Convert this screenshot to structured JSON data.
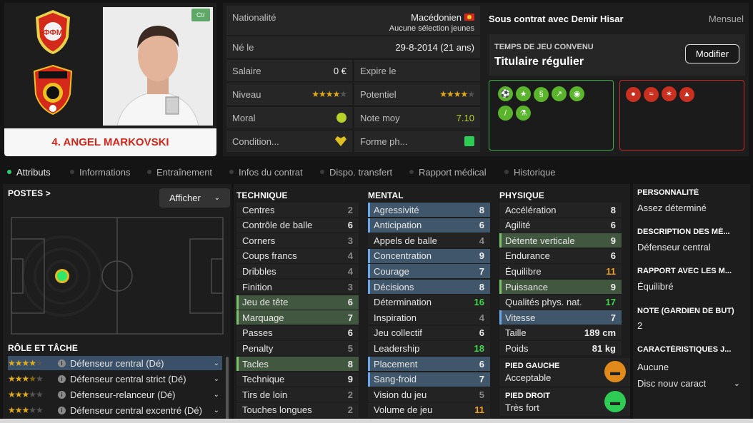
{
  "player": {
    "name": "4. ANGEL MARKOVSKI",
    "position_badge": "Ctr"
  },
  "info": {
    "nationality_label": "Nationalité",
    "nationality": "Macédonien",
    "nationality_sub": "Aucune sélection jeunes",
    "born_label": "Né le",
    "born": "29-8-2014 (21 ans)",
    "salary_label": "Salaire",
    "salary": "0 €",
    "expires_label": "Expire le",
    "level_label": "Niveau",
    "level_stars": 4,
    "potential_label": "Potentiel",
    "potential_stars": 4,
    "morale_label": "Moral",
    "rating_label": "Note moy",
    "rating": "7.10",
    "condition_label": "Condition...",
    "form_label": "Forme ph..."
  },
  "contract": {
    "title": "Sous contrat avec Demir Hisar",
    "type": "Mensuel",
    "playing_time_label": "TEMPS DE JEU CONVENU",
    "playing_time": "Titulaire régulier",
    "modify_label": "Modifier"
  },
  "traits": {
    "positive_icons": [
      "trait-boot-icon",
      "trait-star-icon",
      "trait-dna-icon",
      "trait-growth-icon",
      "trait-brain-icon",
      "trait-bandage-icon",
      "trait-flask-icon"
    ],
    "negative_icons": [
      "trait-ball-icon",
      "trait-tape-icon",
      "trait-injury-icon",
      "trait-warning-icon"
    ],
    "positive_color": "#5ab52c",
    "negative_color": "#c9301f"
  },
  "tabs": [
    "Attributs",
    "Informations",
    "Entraînement",
    "Infos du contrat",
    "Dispo. transfert",
    "Rapport médical",
    "Historique"
  ],
  "positions": {
    "title": "POSTES",
    "show_label": "Afficher"
  },
  "roles": {
    "title": "RÔLE ET TÂCHE",
    "items": [
      {
        "label": "Défenseur central (Dé)",
        "stars": 4
      },
      {
        "label": "Défenseur central strict (Dé)",
        "stars": 3.5
      },
      {
        "label": "Défenseur-relanceur (Dé)",
        "stars": 3
      },
      {
        "label": "Défenseur central excentré (Dé)",
        "stars": 3
      }
    ]
  },
  "technique": {
    "title": "TECHNIQUE",
    "items": [
      {
        "label": "Centres",
        "value": "2",
        "hl": "",
        "c": "lo"
      },
      {
        "label": "Contrôle de balle",
        "value": "6",
        "hl": "",
        "c": ""
      },
      {
        "label": "Corners",
        "value": "3",
        "hl": "",
        "c": "lo"
      },
      {
        "label": "Coups francs",
        "value": "4",
        "hl": "",
        "c": "lo"
      },
      {
        "label": "Dribbles",
        "value": "4",
        "hl": "",
        "c": "lo"
      },
      {
        "label": "Finition",
        "value": "3",
        "hl": "",
        "c": "lo"
      },
      {
        "label": "Jeu de tête",
        "value": "6",
        "hl": "g",
        "c": ""
      },
      {
        "label": "Marquage",
        "value": "7",
        "hl": "g",
        "c": ""
      },
      {
        "label": "Passes",
        "value": "6",
        "hl": "",
        "c": ""
      },
      {
        "label": "Penalty",
        "value": "5",
        "hl": "",
        "c": "lo"
      },
      {
        "label": "Tacles",
        "value": "8",
        "hl": "g",
        "c": ""
      },
      {
        "label": "Technique",
        "value": "9",
        "hl": "",
        "c": ""
      },
      {
        "label": "Tirs de loin",
        "value": "2",
        "hl": "",
        "c": "lo"
      },
      {
        "label": "Touches longues",
        "value": "2",
        "hl": "",
        "c": "lo"
      }
    ]
  },
  "mental": {
    "title": "MENTAL",
    "items": [
      {
        "label": "Agressivité",
        "value": "8",
        "hl": "b",
        "c": ""
      },
      {
        "label": "Anticipation",
        "value": "6",
        "hl": "b",
        "c": ""
      },
      {
        "label": "Appels de balle",
        "value": "4",
        "hl": "",
        "c": "lo"
      },
      {
        "label": "Concentration",
        "value": "9",
        "hl": "b",
        "c": ""
      },
      {
        "label": "Courage",
        "value": "7",
        "hl": "b",
        "c": ""
      },
      {
        "label": "Décisions",
        "value": "8",
        "hl": "b",
        "c": ""
      },
      {
        "label": "Détermination",
        "value": "16",
        "hl": "",
        "c": "grn"
      },
      {
        "label": "Inspiration",
        "value": "4",
        "hl": "",
        "c": "lo"
      },
      {
        "label": "Jeu collectif",
        "value": "6",
        "hl": "",
        "c": ""
      },
      {
        "label": "Leadership",
        "value": "18",
        "hl": "",
        "c": "grn"
      },
      {
        "label": "Placement",
        "value": "6",
        "hl": "b",
        "c": ""
      },
      {
        "label": "Sang-froid",
        "value": "7",
        "hl": "b",
        "c": ""
      },
      {
        "label": "Vision du jeu",
        "value": "5",
        "hl": "",
        "c": "lo"
      },
      {
        "label": "Volume de jeu",
        "value": "11",
        "hl": "",
        "c": "org"
      }
    ]
  },
  "physique": {
    "title": "PHYSIQUE",
    "items": [
      {
        "label": "Accélération",
        "value": "8",
        "hl": "",
        "c": ""
      },
      {
        "label": "Agilité",
        "value": "6",
        "hl": "",
        "c": ""
      },
      {
        "label": "Détente verticale",
        "value": "9",
        "hl": "g",
        "c": ""
      },
      {
        "label": "Endurance",
        "value": "6",
        "hl": "",
        "c": ""
      },
      {
        "label": "Équilibre",
        "value": "11",
        "hl": "",
        "c": "org"
      },
      {
        "label": "Puissance",
        "value": "9",
        "hl": "g",
        "c": ""
      },
      {
        "label": "Qualités phys. nat.",
        "value": "17",
        "hl": "",
        "c": "grn"
      },
      {
        "label": "Vitesse",
        "value": "7",
        "hl": "b",
        "c": ""
      }
    ],
    "height_label": "Taille",
    "height": "189 cm",
    "weight_label": "Poids",
    "weight": "81 kg",
    "left_foot_label": "PIED GAUCHE",
    "left_foot": "Acceptable",
    "left_foot_color": "#e08a1c",
    "right_foot_label": "PIED DROIT",
    "right_foot": "Très fort",
    "right_foot_color": "#2ecc55"
  },
  "personality": {
    "personality_label": "PERSONNALITÉ",
    "personality": "Assez déterminé",
    "description_label": "DESCRIPTION DES MÉ...",
    "description": "Défenseur central",
    "relation_label": "RAPPORT AVEC LES M...",
    "relation": "Équilibré",
    "gk_label": "NOTE (GARDIEN DE BUT)",
    "gk": "2",
    "char_label": "CARACTÉRISTIQUES J...",
    "char": "Aucune",
    "char_new": "Disc nouv caract"
  }
}
